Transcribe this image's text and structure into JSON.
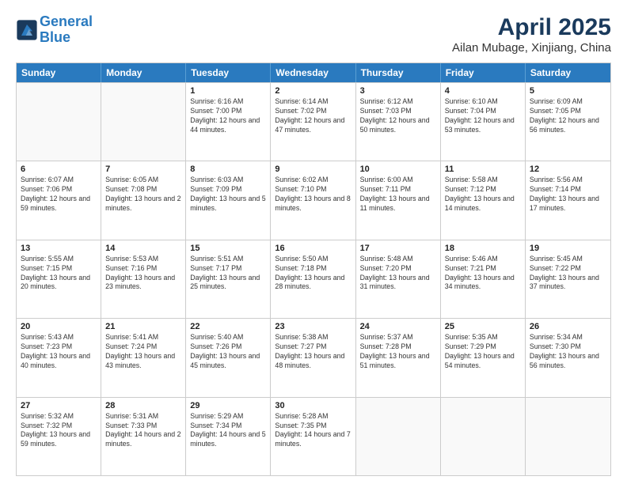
{
  "header": {
    "logo_line1": "General",
    "logo_line2": "Blue",
    "month": "April 2025",
    "location": "Ailan Mubage, Xinjiang, China"
  },
  "weekdays": [
    "Sunday",
    "Monday",
    "Tuesday",
    "Wednesday",
    "Thursday",
    "Friday",
    "Saturday"
  ],
  "rows": [
    [
      {
        "day": "",
        "text": ""
      },
      {
        "day": "",
        "text": ""
      },
      {
        "day": "1",
        "text": "Sunrise: 6:16 AM\nSunset: 7:00 PM\nDaylight: 12 hours and 44 minutes."
      },
      {
        "day": "2",
        "text": "Sunrise: 6:14 AM\nSunset: 7:02 PM\nDaylight: 12 hours and 47 minutes."
      },
      {
        "day": "3",
        "text": "Sunrise: 6:12 AM\nSunset: 7:03 PM\nDaylight: 12 hours and 50 minutes."
      },
      {
        "day": "4",
        "text": "Sunrise: 6:10 AM\nSunset: 7:04 PM\nDaylight: 12 hours and 53 minutes."
      },
      {
        "day": "5",
        "text": "Sunrise: 6:09 AM\nSunset: 7:05 PM\nDaylight: 12 hours and 56 minutes."
      }
    ],
    [
      {
        "day": "6",
        "text": "Sunrise: 6:07 AM\nSunset: 7:06 PM\nDaylight: 12 hours and 59 minutes."
      },
      {
        "day": "7",
        "text": "Sunrise: 6:05 AM\nSunset: 7:08 PM\nDaylight: 13 hours and 2 minutes."
      },
      {
        "day": "8",
        "text": "Sunrise: 6:03 AM\nSunset: 7:09 PM\nDaylight: 13 hours and 5 minutes."
      },
      {
        "day": "9",
        "text": "Sunrise: 6:02 AM\nSunset: 7:10 PM\nDaylight: 13 hours and 8 minutes."
      },
      {
        "day": "10",
        "text": "Sunrise: 6:00 AM\nSunset: 7:11 PM\nDaylight: 13 hours and 11 minutes."
      },
      {
        "day": "11",
        "text": "Sunrise: 5:58 AM\nSunset: 7:12 PM\nDaylight: 13 hours and 14 minutes."
      },
      {
        "day": "12",
        "text": "Sunrise: 5:56 AM\nSunset: 7:14 PM\nDaylight: 13 hours and 17 minutes."
      }
    ],
    [
      {
        "day": "13",
        "text": "Sunrise: 5:55 AM\nSunset: 7:15 PM\nDaylight: 13 hours and 20 minutes."
      },
      {
        "day": "14",
        "text": "Sunrise: 5:53 AM\nSunset: 7:16 PM\nDaylight: 13 hours and 23 minutes."
      },
      {
        "day": "15",
        "text": "Sunrise: 5:51 AM\nSunset: 7:17 PM\nDaylight: 13 hours and 25 minutes."
      },
      {
        "day": "16",
        "text": "Sunrise: 5:50 AM\nSunset: 7:18 PM\nDaylight: 13 hours and 28 minutes."
      },
      {
        "day": "17",
        "text": "Sunrise: 5:48 AM\nSunset: 7:20 PM\nDaylight: 13 hours and 31 minutes."
      },
      {
        "day": "18",
        "text": "Sunrise: 5:46 AM\nSunset: 7:21 PM\nDaylight: 13 hours and 34 minutes."
      },
      {
        "day": "19",
        "text": "Sunrise: 5:45 AM\nSunset: 7:22 PM\nDaylight: 13 hours and 37 minutes."
      }
    ],
    [
      {
        "day": "20",
        "text": "Sunrise: 5:43 AM\nSunset: 7:23 PM\nDaylight: 13 hours and 40 minutes."
      },
      {
        "day": "21",
        "text": "Sunrise: 5:41 AM\nSunset: 7:24 PM\nDaylight: 13 hours and 43 minutes."
      },
      {
        "day": "22",
        "text": "Sunrise: 5:40 AM\nSunset: 7:26 PM\nDaylight: 13 hours and 45 minutes."
      },
      {
        "day": "23",
        "text": "Sunrise: 5:38 AM\nSunset: 7:27 PM\nDaylight: 13 hours and 48 minutes."
      },
      {
        "day": "24",
        "text": "Sunrise: 5:37 AM\nSunset: 7:28 PM\nDaylight: 13 hours and 51 minutes."
      },
      {
        "day": "25",
        "text": "Sunrise: 5:35 AM\nSunset: 7:29 PM\nDaylight: 13 hours and 54 minutes."
      },
      {
        "day": "26",
        "text": "Sunrise: 5:34 AM\nSunset: 7:30 PM\nDaylight: 13 hours and 56 minutes."
      }
    ],
    [
      {
        "day": "27",
        "text": "Sunrise: 5:32 AM\nSunset: 7:32 PM\nDaylight: 13 hours and 59 minutes."
      },
      {
        "day": "28",
        "text": "Sunrise: 5:31 AM\nSunset: 7:33 PM\nDaylight: 14 hours and 2 minutes."
      },
      {
        "day": "29",
        "text": "Sunrise: 5:29 AM\nSunset: 7:34 PM\nDaylight: 14 hours and 5 minutes."
      },
      {
        "day": "30",
        "text": "Sunrise: 5:28 AM\nSunset: 7:35 PM\nDaylight: 14 hours and 7 minutes."
      },
      {
        "day": "",
        "text": ""
      },
      {
        "day": "",
        "text": ""
      },
      {
        "day": "",
        "text": ""
      }
    ]
  ]
}
